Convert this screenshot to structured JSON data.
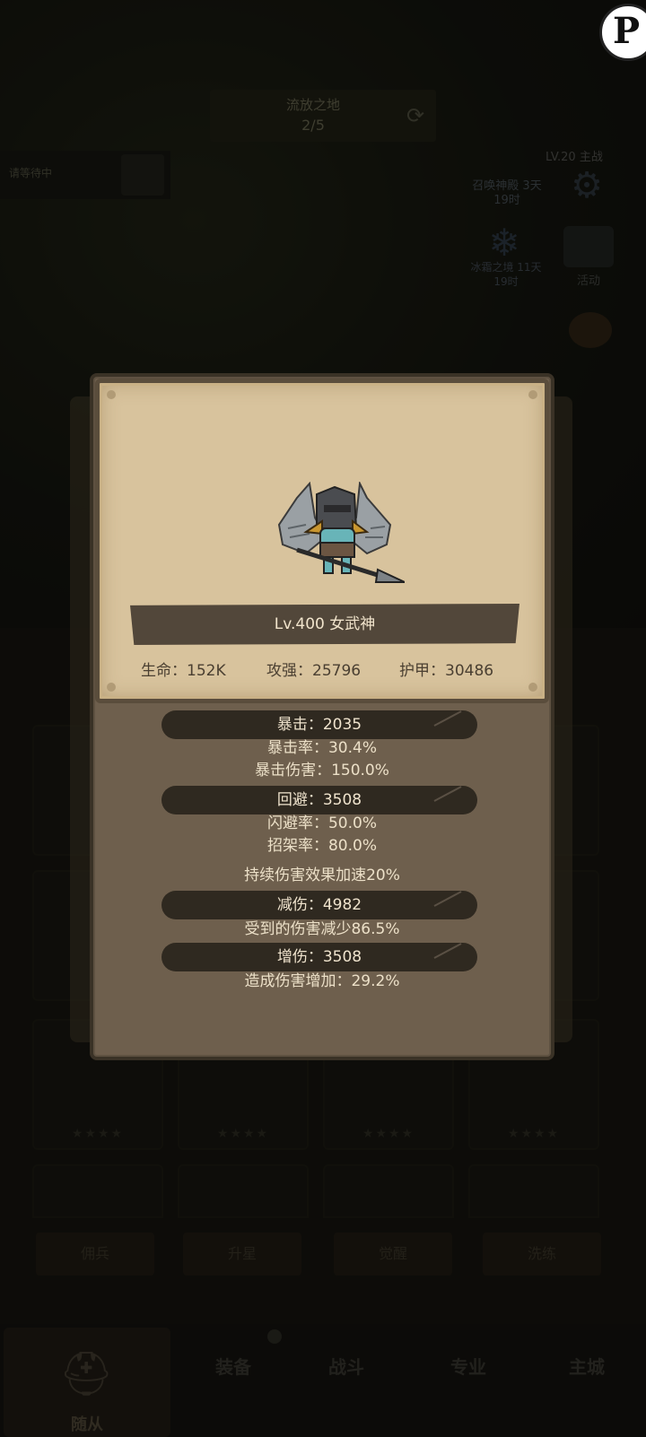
{
  "background": {
    "stage_title": "流放之地",
    "stage_progress": "2/5",
    "info_text": "请等待中",
    "event_label": "召唤神殿 3天19时",
    "level_tag": "LV.20 主战",
    "snow_label": "冰霜之境 11天19时",
    "chest_label": "活动",
    "buttons": [
      "佣兵",
      "升星",
      "觉醒",
      "洗练"
    ],
    "nav": {
      "active_label": "随从",
      "items": [
        "装备",
        "战斗",
        "专业",
        "主城"
      ]
    }
  },
  "dialog": {
    "name_line": "Lv.400 女武神",
    "stats": {
      "hp": "生命：152K",
      "atk": "攻强：25796",
      "armor": "护甲：30486"
    },
    "crit": "暴击：2035",
    "crit_rate": "暴击率：30.4%",
    "crit_damage": "暴击伤害：150.0%",
    "dodge": "回避：3508",
    "dodge_rate": "闪避率：50.0%",
    "parry_rate": "招架率：80.0%",
    "dot_speed": "持续伤害效果加速20%",
    "reduction": "减伤：4982",
    "reduction_desc": "受到的伤害减少86.5%",
    "amplify": "增伤：3508",
    "amplify_desc": "造成伤害增加：29.2%"
  },
  "colors": {
    "card_bg": "#d8c39d",
    "dialog_bg": "#6e5f4d",
    "pill_bg": "#2f2920",
    "text_light": "#ece0c8",
    "text_dark": "#4a3f31"
  },
  "icons": {
    "character": "valkyrie-sprite",
    "badge": "p-logo-icon",
    "gear": "gear-icon",
    "snow": "snowflake-icon",
    "helmet": "helmet-icon"
  }
}
